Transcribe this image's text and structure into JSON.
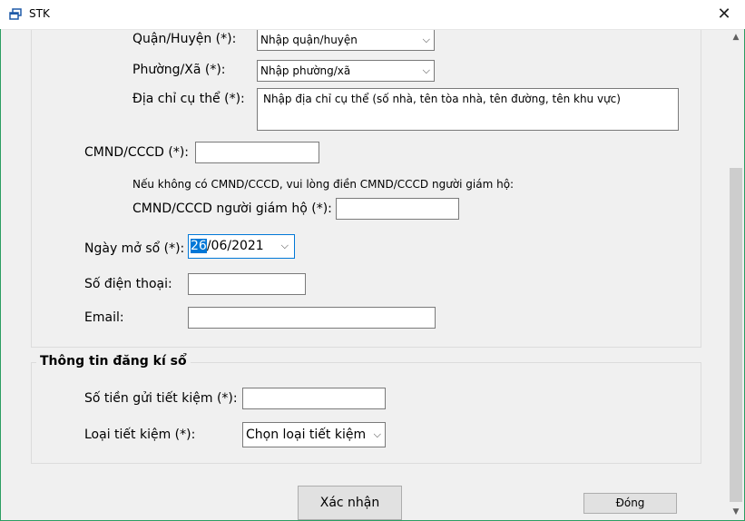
{
  "window": {
    "title": "STK",
    "close_glyph": "✕"
  },
  "address": {
    "district_label": "Quận/Huyện (*):",
    "district_value": "Nhập quận/huyện",
    "ward_label": "Phường/Xã (*):",
    "ward_value": "Nhập phường/xã",
    "detail_label": "Địa chỉ cụ thể (*):",
    "detail_placeholder": "Nhập địa chỉ cụ thể (số nhà, tên tòa nhà, tên đường, tên khu vực)"
  },
  "identity": {
    "id_label": "CMND/CCCD (*):",
    "id_value": "",
    "guardian_note": "Nếu không có CMND/CCCD, vui lòng điền CMND/CCCD người giám hộ:",
    "guardian_label": "CMND/CCCD người giám hộ (*):",
    "guardian_value": ""
  },
  "open_date": {
    "label": "Ngày mở sổ (*):",
    "day_selected": "26",
    "rest": "/06/2021"
  },
  "phone": {
    "label": "Số điện thoại:",
    "value": ""
  },
  "email": {
    "label": "Email:",
    "value": ""
  },
  "registration": {
    "group_title": "Thông tin đăng kí sổ",
    "deposit_label": "Số tiền gửi tiết kiệm (*):",
    "deposit_value": "",
    "type_label": "Loại tiết kiệm (*):",
    "type_value": "Chọn loại tiết kiệm"
  },
  "actions": {
    "confirm_label": "Xác nhận",
    "close_label": "Đóng"
  },
  "colors": {
    "frame": "#2c9e62",
    "accent": "#0078d7"
  }
}
